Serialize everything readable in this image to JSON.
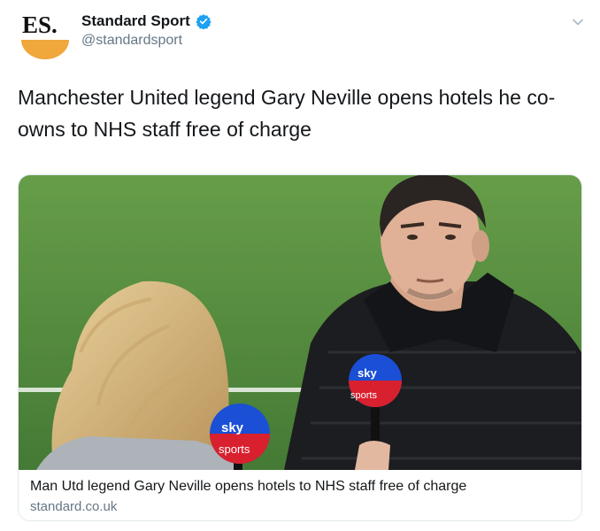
{
  "account": {
    "logo_text": "ES.",
    "display_name": "Standard Sport",
    "handle": "@standardsport"
  },
  "tweet": {
    "text": "Manchester United legend Gary Neville opens hotels he co-owns to NHS staff free of charge"
  },
  "card": {
    "title": "Man Utd legend Gary Neville opens hotels to NHS staff free of charge",
    "domain": "standard.co.uk",
    "mic_left": {
      "line1": "sky",
      "line2": "sports"
    },
    "mic_right": {
      "line1": "sky",
      "line2": "sports"
    }
  },
  "colors": {
    "verified": "#1da1f2",
    "logo_accent": "#f0a73c",
    "pitch": "#4f8a3c",
    "mic_blue": "#1a4fd6",
    "mic_red": "#d9202e"
  }
}
